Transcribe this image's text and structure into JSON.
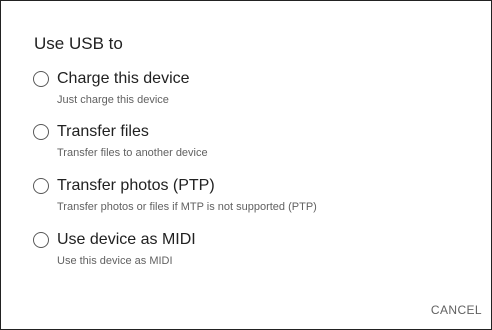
{
  "dialog": {
    "title": "Use USB to",
    "options": [
      {
        "label": "Charge this device",
        "description": "Just charge this device",
        "selected": false
      },
      {
        "label": "Transfer files",
        "description": "Transfer files to another device",
        "selected": false
      },
      {
        "label": "Transfer photos (PTP)",
        "description": "Transfer photos or files if MTP is not supported (PTP)",
        "selected": false
      },
      {
        "label": "Use device as MIDI",
        "description": "Use this device as MIDI",
        "selected": false
      }
    ],
    "cancel_label": "CANCEL"
  },
  "colors": {
    "text_primary": "#212121",
    "text_secondary": "#616161",
    "radio_border": "#595959",
    "border": "#222222"
  }
}
